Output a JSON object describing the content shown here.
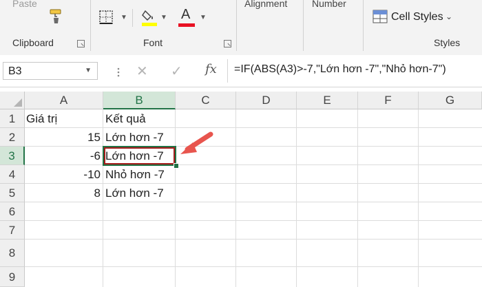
{
  "ribbon": {
    "paste_label": "Paste",
    "clipboard_label": "Clipboard",
    "font_label": "Font",
    "alignment_label": "Alignment",
    "number_label": "Number",
    "cell_styles_label": "Cell Styles",
    "styles_label": "Styles",
    "font_color_letter": "A",
    "colors": {
      "highlight": "#ffff00",
      "font_color": "#e81123"
    }
  },
  "formula_bar": {
    "name_box": "B3",
    "formula": "=IF(ABS(A3)>-7,\"Lớn hơn -7\",\"Nhỏ hơn-7\")",
    "fx_label": "fx"
  },
  "grid": {
    "columns": [
      "A",
      "B",
      "C",
      "D",
      "E",
      "F",
      "G"
    ],
    "rows": [
      "1",
      "2",
      "3",
      "4",
      "5",
      "6",
      "7",
      "8",
      "9"
    ],
    "selected_cell": "B3",
    "cells": {
      "A1": "Giá trị",
      "B1": "Kết quả",
      "A2": "15",
      "B2": "Lớn hơn -7",
      "A3": "-6",
      "B3": "Lớn hơn -7",
      "A4": "-10",
      "B4": "Nhỏ hơn -7",
      "A5": "8",
      "B5": "Lớn hơn -7"
    }
  },
  "annotation": {
    "color": "#e8554e",
    "box_color": "#a31b1b"
  }
}
